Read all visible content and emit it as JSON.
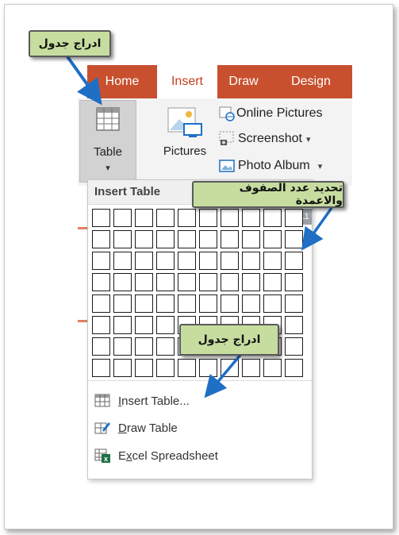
{
  "tabs": [
    {
      "label": "Home",
      "active": false
    },
    {
      "label": "Insert",
      "active": true
    },
    {
      "label": "Draw",
      "active": false
    },
    {
      "label": "Design",
      "active": false
    }
  ],
  "ribbon": {
    "table_label": "Table",
    "table_caret": "▾",
    "pictures_label": "Pictures",
    "online_pictures": "Online Pictures",
    "screenshot": "Screenshot",
    "screenshot_caret": "▾",
    "photo_album": "Photo Album",
    "photo_album_caret": "▾"
  },
  "dropdown": {
    "header": "Insert Table",
    "grid_cols": 10,
    "grid_rows": 8,
    "partial_text": "11",
    "items": [
      {
        "label": "Insert Table...",
        "icon": "table-grid-icon"
      },
      {
        "label": "Draw Table",
        "icon": "pencil-table-icon"
      },
      {
        "label": "Excel Spreadsheet",
        "icon": "excel-icon"
      }
    ]
  },
  "callouts": {
    "top": "ادراج جدول",
    "right": "تحديد عدد الصفوف والاعمدة",
    "bottom": "ادراج جدول"
  },
  "colors": {
    "tab_bar": "#c8502e",
    "active_tab_text": "#c43e1c",
    "callout_fill": "#c7dda0",
    "arrow": "#1f6fc4"
  }
}
